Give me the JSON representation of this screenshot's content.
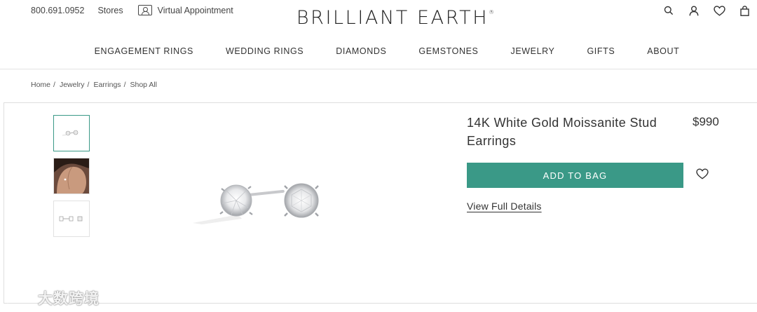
{
  "header": {
    "phone": "800.691.0952",
    "stores_label": "Stores",
    "appointment_label": "Virtual Appointment",
    "logo_text": "BRILLIANT EARTH",
    "logo_mark": "®",
    "icons": [
      "search-icon",
      "account-icon",
      "heart-icon",
      "bag-icon"
    ]
  },
  "nav": {
    "items": [
      "ENGAGEMENT RINGS",
      "WEDDING RINGS",
      "DIAMONDS",
      "GEMSTONES",
      "JEWELRY",
      "GIFTS",
      "ABOUT"
    ]
  },
  "breadcrumb": {
    "items": [
      "Home",
      "Jewelry",
      "Earrings",
      "Shop All"
    ],
    "separator": "/"
  },
  "product": {
    "title": "14K White Gold Moissanite Stud Earrings",
    "price": "$990",
    "add_to_bag_label": "ADD TO BAG",
    "details_label": "View Full Details",
    "accent_color": "#3a9987",
    "thumbnails": [
      "earrings-pair-thumbnail",
      "model-wearing-earring-thumbnail",
      "earrings-side-view-thumbnail"
    ],
    "selected_thumbnail": 0
  },
  "watermark": {
    "text": "大数跨境"
  }
}
